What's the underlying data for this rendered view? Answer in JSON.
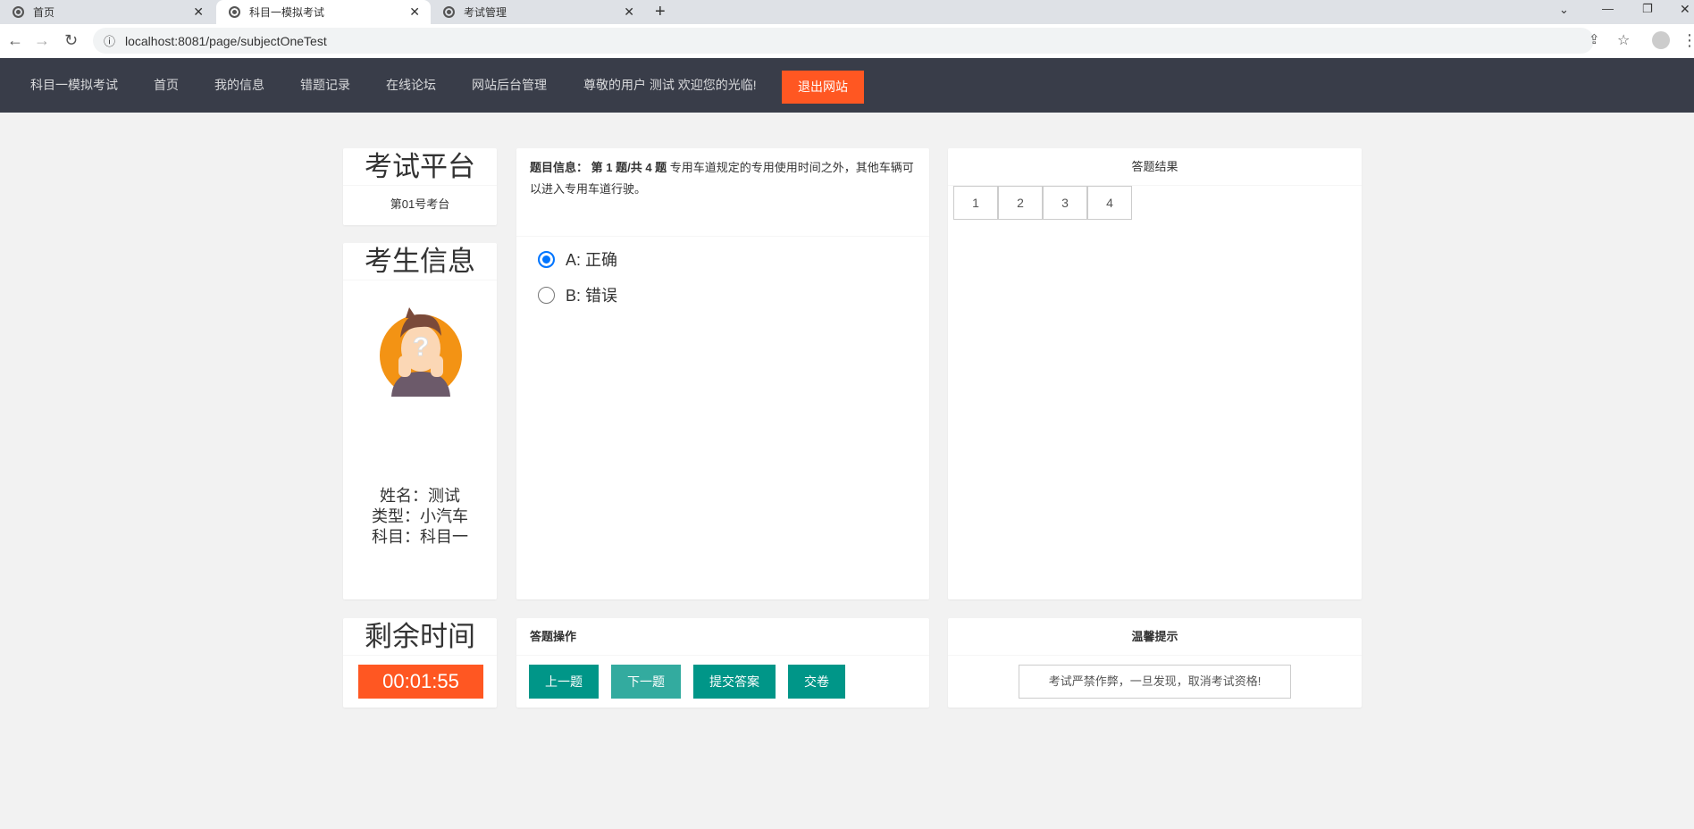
{
  "browser": {
    "tabs": [
      {
        "label": "首页"
      },
      {
        "label": "科目一模拟考试",
        "active": true
      },
      {
        "label": "考试管理"
      }
    ],
    "url": "localhost:8081/page/subjectOneTest"
  },
  "nav": {
    "brand": "科目一模拟考试",
    "items": [
      "首页",
      "我的信息",
      "错题记录",
      "在线论坛",
      "网站后台管理"
    ],
    "greeting": "尊敬的用户 测试 欢迎您的光临!",
    "logout": "退出网站"
  },
  "platform": {
    "title": "考试平台",
    "station": "第01号考台"
  },
  "examinee": {
    "title": "考生信息",
    "name": "姓名：测试",
    "type": "类型：小汽车",
    "subject": "科目：科目一"
  },
  "question": {
    "label": "题目信息：",
    "progress": "第 1 题/共 4 题",
    "text": "专用车道规定的专用使用时间之外，其他车辆可以进入专用车道行驶。",
    "options": [
      {
        "label": "A:  正确",
        "selected": true
      },
      {
        "label": "B:  错误",
        "selected": false
      }
    ]
  },
  "results": {
    "title": "答题结果",
    "items": [
      "1",
      "2",
      "3",
      "4"
    ]
  },
  "timer": {
    "title": "剩余时间",
    "value": "00:01:55"
  },
  "ops": {
    "title": "答题操作",
    "prev": "上一题",
    "next": "下一题",
    "submit": "提交答案",
    "finish": "交卷"
  },
  "tips": {
    "title": "温馨提示",
    "text": "考试严禁作弊，一旦发现，取消考试资格!"
  },
  "colors": {
    "nav": "#393d49",
    "accent": "#ff5722",
    "button": "#009688"
  }
}
